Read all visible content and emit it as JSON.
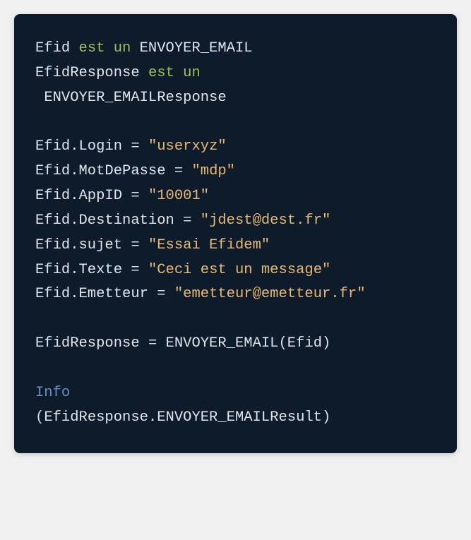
{
  "code": {
    "lines": [
      [
        {
          "cls": "tk-default",
          "t": "Efid "
        },
        {
          "cls": "tk-keyword",
          "t": "est un"
        },
        {
          "cls": "tk-default",
          "t": " ENVOYER_EMAIL"
        }
      ],
      [
        {
          "cls": "tk-default",
          "t": "EfidResponse "
        },
        {
          "cls": "tk-keyword",
          "t": "est un"
        }
      ],
      [
        {
          "cls": "tk-default",
          "t": " ENVOYER_EMAILResponse"
        }
      ],
      [
        {
          "cls": "tk-default",
          "t": " "
        }
      ],
      [
        {
          "cls": "tk-default",
          "t": "Efid.Login "
        },
        {
          "cls": "tk-punct",
          "t": "="
        },
        {
          "cls": "tk-default",
          "t": " "
        },
        {
          "cls": "tk-string",
          "t": "\"userxyz\""
        }
      ],
      [
        {
          "cls": "tk-default",
          "t": "Efid.MotDePasse "
        },
        {
          "cls": "tk-punct",
          "t": "="
        },
        {
          "cls": "tk-default",
          "t": " "
        },
        {
          "cls": "tk-string",
          "t": "\"mdp\""
        }
      ],
      [
        {
          "cls": "tk-default",
          "t": "Efid.AppID "
        },
        {
          "cls": "tk-punct",
          "t": "="
        },
        {
          "cls": "tk-default",
          "t": " "
        },
        {
          "cls": "tk-string",
          "t": "\"10001\""
        }
      ],
      [
        {
          "cls": "tk-default",
          "t": "Efid.Destination "
        },
        {
          "cls": "tk-punct",
          "t": "="
        },
        {
          "cls": "tk-default",
          "t": " "
        },
        {
          "cls": "tk-string",
          "t": "\"jdest@dest.fr\""
        }
      ],
      [
        {
          "cls": "tk-default",
          "t": "Efid.sujet "
        },
        {
          "cls": "tk-punct",
          "t": "="
        },
        {
          "cls": "tk-default",
          "t": " "
        },
        {
          "cls": "tk-string",
          "t": "\"Essai Efidem\""
        }
      ],
      [
        {
          "cls": "tk-default",
          "t": "Efid.Texte "
        },
        {
          "cls": "tk-punct",
          "t": "="
        },
        {
          "cls": "tk-default",
          "t": " "
        },
        {
          "cls": "tk-string",
          "t": "\"Ceci est un message\""
        }
      ],
      [
        {
          "cls": "tk-default",
          "t": "Efid.Emetteur "
        },
        {
          "cls": "tk-punct",
          "t": "="
        },
        {
          "cls": "tk-default",
          "t": " "
        },
        {
          "cls": "tk-string",
          "t": "\"emetteur@emetteur.fr\""
        }
      ],
      [
        {
          "cls": "tk-default",
          "t": " "
        }
      ],
      [
        {
          "cls": "tk-default",
          "t": "EfidResponse "
        },
        {
          "cls": "tk-punct",
          "t": "="
        },
        {
          "cls": "tk-default",
          "t": " ENVOYER_EMAIL"
        },
        {
          "cls": "tk-punct",
          "t": "("
        },
        {
          "cls": "tk-default",
          "t": "Efid"
        },
        {
          "cls": "tk-punct",
          "t": ")"
        }
      ],
      [
        {
          "cls": "tk-default",
          "t": " "
        }
      ],
      [
        {
          "cls": "tk-info",
          "t": "Info"
        }
      ],
      [
        {
          "cls": "tk-punct",
          "t": "("
        },
        {
          "cls": "tk-default",
          "t": "EfidResponse.ENVOYER_EMAILResult"
        },
        {
          "cls": "tk-punct",
          "t": ")"
        }
      ]
    ]
  }
}
